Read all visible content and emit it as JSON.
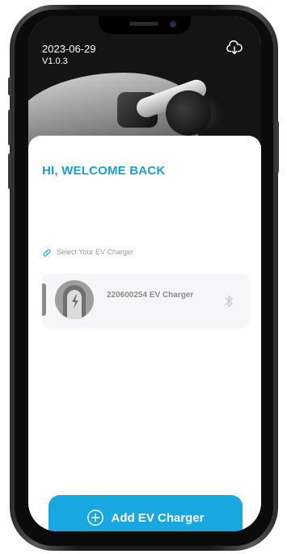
{
  "header": {
    "date": "2023-06-29",
    "version": "V1.0.3",
    "cloud_icon": "cloud-download-icon"
  },
  "welcome": {
    "title": "HI, WELCOME BACK"
  },
  "chargers": {
    "section_label": "Select Your EV Charger",
    "section_icon": "link-icon",
    "items": [
      {
        "name": "220600254 EV Charger",
        "icon": "ev-charger-icon",
        "status_icon": "bluetooth-icon"
      }
    ]
  },
  "actions": {
    "add_label": "Add EV Charger",
    "add_icon": "plus-circle-icon"
  },
  "colors": {
    "accent": "#17a0d8",
    "button": "#18a7e0",
    "muted_text": "#9a9a9a"
  }
}
